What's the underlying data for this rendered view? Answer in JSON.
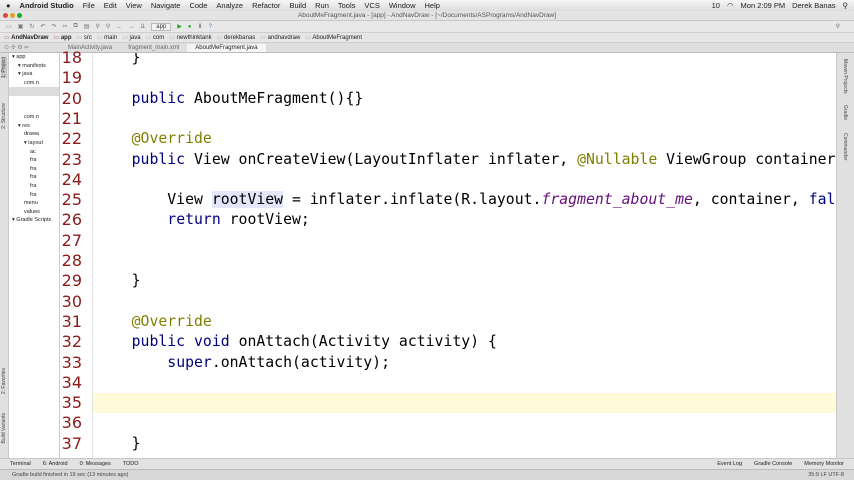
{
  "menubar": {
    "app": "Android Studio",
    "items": [
      "File",
      "Edit",
      "View",
      "Navigate",
      "Code",
      "Analyze",
      "Refactor",
      "Build",
      "Run",
      "Tools",
      "VCS",
      "Window",
      "Help"
    ],
    "tray_count": "10",
    "clock": "Mon 2:09 PM",
    "user": "Derek Banas"
  },
  "window_title": "AboutMeFragment.java - [app] - AndNavDraw - [~/Documents/ASPrograms/AndNavDraw]",
  "toolbar": {
    "run_config": "app"
  },
  "breadcrumbs": [
    "AndNavDraw",
    "app",
    "src",
    "main",
    "java",
    "com",
    "newthinktank",
    "derekbanas",
    "andnavdraw",
    "AboutMeFragment"
  ],
  "tabs": [
    {
      "label": "MainActivity.java"
    },
    {
      "label": "fragment_main.xml"
    },
    {
      "label": "AboutMeFragment.java"
    }
  ],
  "left_panels": {
    "project": "1: Project",
    "structure": "2: Structure",
    "favorites": "2: Favorites",
    "build_variants": "Build Variants"
  },
  "right_panels": {
    "maven": "Maven Projects",
    "gradle": "Gradle",
    "commander": "Commander"
  },
  "tree": [
    "app",
    "manifests",
    "java",
    "com.n",
    "",
    "",
    "",
    "com.n",
    "res",
    "drawa",
    "layout",
    "ac",
    "fra",
    "fra",
    "fra",
    "fra",
    "fra",
    "menu",
    "values",
    "Gradle Scripts"
  ],
  "code": {
    "current_line": "35",
    "lines": [
      {
        "n": "18",
        "t": "    }"
      },
      {
        "n": "19",
        "t": ""
      },
      {
        "n": "20",
        "t": "    public AboutMeFragment(){}"
      },
      {
        "n": "21",
        "t": ""
      },
      {
        "n": "22",
        "t": "    @Override"
      },
      {
        "n": "23",
        "t": "    public View onCreateView(LayoutInflater inflater, @Nullable ViewGroup container"
      },
      {
        "n": "24",
        "t": ""
      },
      {
        "n": "25",
        "t": "        View rootView = inflater.inflate(R.layout.fragment_about_me, container, false"
      },
      {
        "n": "26",
        "t": "        return rootView;"
      },
      {
        "n": "27",
        "t": ""
      },
      {
        "n": "28",
        "t": ""
      },
      {
        "n": "29",
        "t": "    }"
      },
      {
        "n": "30",
        "t": ""
      },
      {
        "n": "31",
        "t": "    @Override"
      },
      {
        "n": "32",
        "t": "    public void onAttach(Activity activity) {"
      },
      {
        "n": "33",
        "t": "        super.onAttach(activity);"
      },
      {
        "n": "34",
        "t": ""
      },
      {
        "n": "35",
        "t": ""
      },
      {
        "n": "36",
        "t": ""
      },
      {
        "n": "37",
        "t": "    }"
      }
    ]
  },
  "bottom_tools": {
    "terminal": "Terminal",
    "android": "6: Android",
    "messages": "0: Messages",
    "todo": "TODO",
    "event_log": "Event Log",
    "gradle_console": "Gradle Console",
    "memory_monitor": "Memory Monitor"
  },
  "status": {
    "message": "Gradle build finished in 19 sec (13 minutes ago)",
    "position": "35:9",
    "line_sep": "LF",
    "encoding": "UTF-8"
  }
}
